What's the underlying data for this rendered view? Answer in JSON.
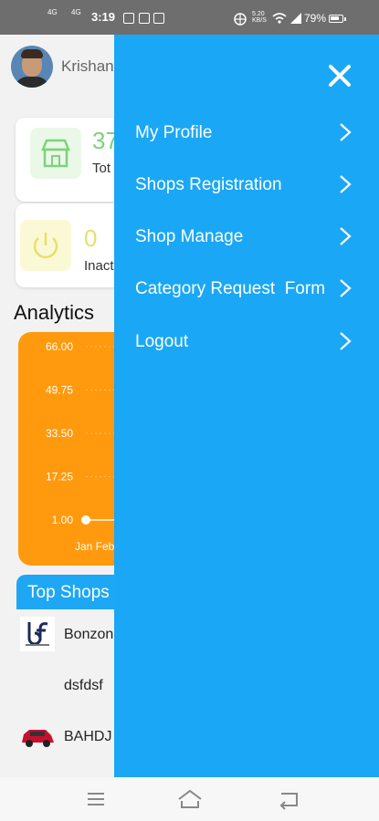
{
  "status_bar": {
    "time": "3:19",
    "signal_1": "4G",
    "signal_2": "4G",
    "net_speed": "5.20 KB/S",
    "battery": "79%"
  },
  "profile": {
    "name": "Krishan"
  },
  "cards": [
    {
      "value": "37",
      "label": "Tot",
      "color": "#7ed27a",
      "icon": "store-icon"
    },
    {
      "value": "0",
      "label": "Inact",
      "color": "#e6e06a",
      "icon": "power-icon"
    }
  ],
  "analytics": {
    "title": "Analytics"
  },
  "chart_data": {
    "type": "line",
    "title": "",
    "categories": [
      "Jan",
      "Feb"
    ],
    "series": [
      {
        "values": [
          1.0,
          1.0
        ]
      }
    ],
    "y_ticks": [
      "66.00",
      "49.75",
      "33.50",
      "17.25",
      "1.00"
    ],
    "x_tick_text": "Jan Feb",
    "ylim": [
      1.0,
      66.0
    ],
    "color": "#ff9a0e"
  },
  "top_shops": {
    "title": "Top Shops",
    "items": [
      {
        "name": "Bonzon",
        "logo": "bf-logo-icon"
      },
      {
        "name": "dsfdsf",
        "logo": ""
      },
      {
        "name": "BAHDJ",
        "logo": "car-icon"
      }
    ]
  },
  "drawer": {
    "accent": "#1aa7f5",
    "items": [
      {
        "label": "My Profile"
      },
      {
        "label": "Shops Registration"
      },
      {
        "label": "Shop Manage"
      },
      {
        "label": "Category Request  Form"
      },
      {
        "label": "Logout"
      }
    ]
  }
}
